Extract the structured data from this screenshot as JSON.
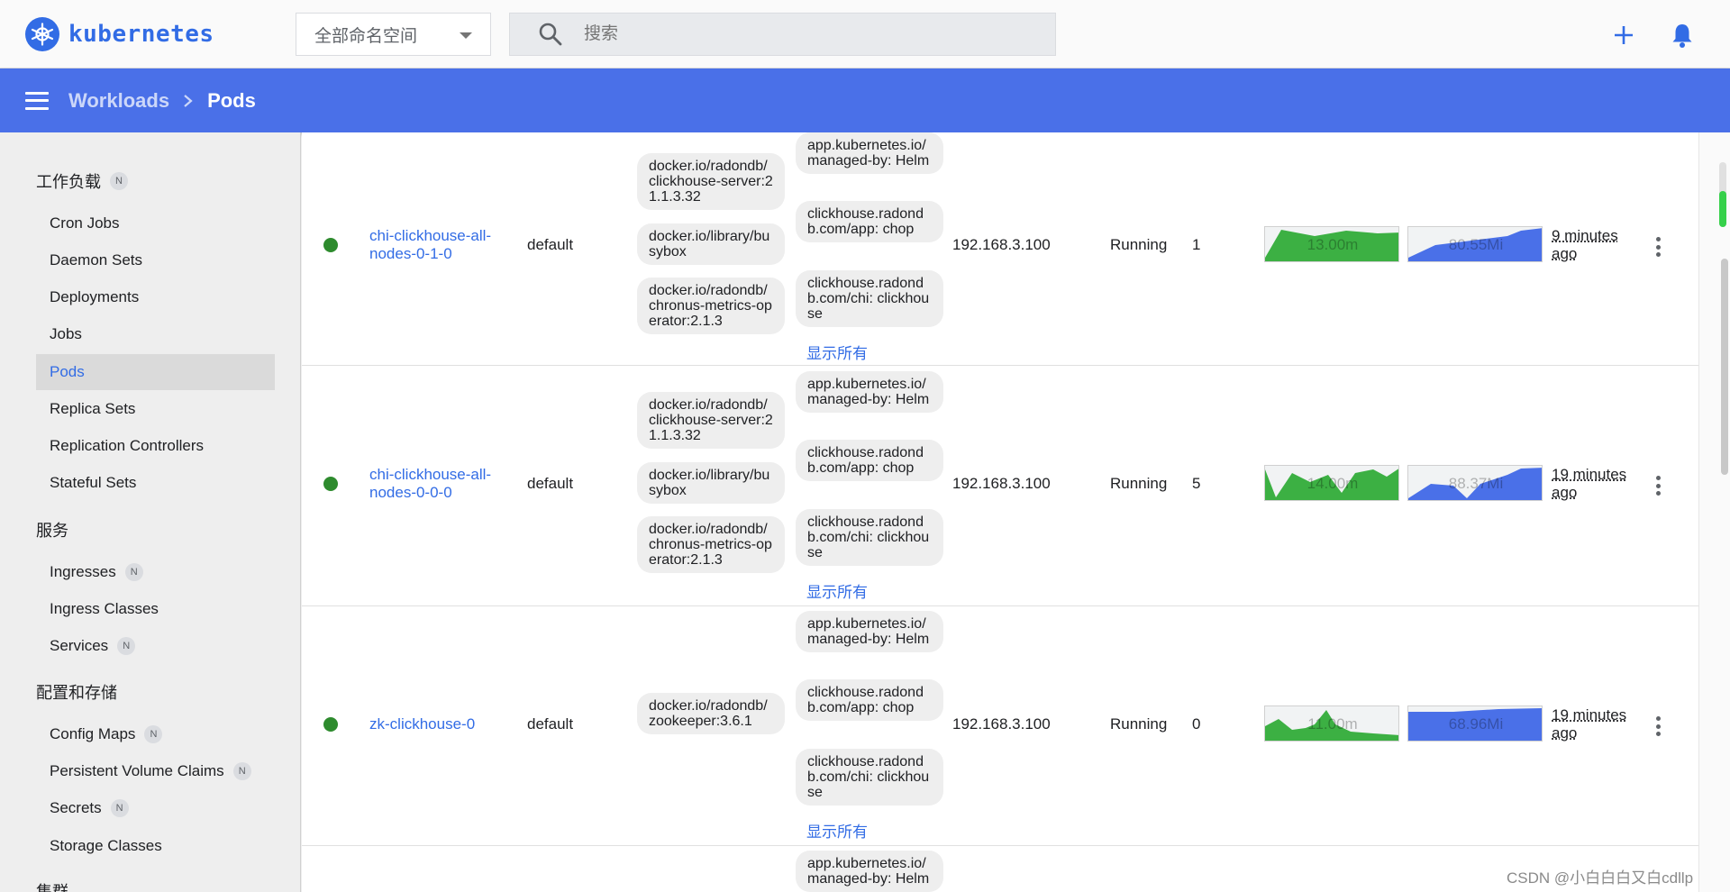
{
  "topbar": {
    "logo_text": "kubernetes",
    "namespace_select": "全部命名空间",
    "search_placeholder": "搜索"
  },
  "breadcrumb": {
    "parent": "Workloads",
    "current": "Pods"
  },
  "sidebar": {
    "sections": [
      {
        "label": "工作负载",
        "badge": "N"
      },
      {
        "label": "服务"
      },
      {
        "label": "配置和存储"
      },
      {
        "label": "集群"
      }
    ],
    "workloads": [
      "Cron Jobs",
      "Daemon Sets",
      "Deployments",
      "Jobs",
      "Pods",
      "Replica Sets",
      "Replication Controllers",
      "Stateful Sets"
    ],
    "services": [
      {
        "label": "Ingresses",
        "badge": "N"
      },
      {
        "label": "Ingress Classes"
      },
      {
        "label": "Services",
        "badge": "N"
      }
    ],
    "config": [
      {
        "label": "Config Maps",
        "badge": "N"
      },
      {
        "label": "Persistent Volume Claims",
        "badge": "N"
      },
      {
        "label": "Secrets",
        "badge": "N"
      },
      {
        "label": "Storage Classes"
      }
    ],
    "active": "Pods"
  },
  "pods": [
    {
      "name": "chi-clickhouse-all-nodes-0-1-0",
      "namespace": "default",
      "images": [
        "docker.io/radondb/clickhouse-server:21.1.3.32",
        "docker.io/library/busybox",
        "docker.io/radondb/chronus-metrics-operator:2.1.3"
      ],
      "labels": [
        "app.kubernetes.io/managed-by: Helm",
        "clickhouse.radondb.com/app: chop",
        "clickhouse.radondb.com/chi: clickhouse"
      ],
      "show_all": "显示所有",
      "node": "192.168.3.100",
      "status": "Running",
      "restarts": "1",
      "cpu": "13.00m",
      "memory": "80.55Mi",
      "age": "9 minutes ago"
    },
    {
      "name": "chi-clickhouse-all-nodes-0-0-0",
      "namespace": "default",
      "images": [
        "docker.io/radondb/clickhouse-server:21.1.3.32",
        "docker.io/library/busybox",
        "docker.io/radondb/chronus-metrics-operator:2.1.3"
      ],
      "labels": [
        "app.kubernetes.io/managed-by: Helm",
        "clickhouse.radondb.com/app: chop",
        "clickhouse.radondb.com/chi: clickhouse"
      ],
      "show_all": "显示所有",
      "node": "192.168.3.100",
      "status": "Running",
      "restarts": "5",
      "cpu": "14.00m",
      "memory": "88.37Mi",
      "age": "19 minutes ago"
    },
    {
      "name": "zk-clickhouse-0",
      "namespace": "default",
      "images": [
        "docker.io/radondb/zookeeper:3.6.1"
      ],
      "labels": [
        "app.kubernetes.io/managed-by: Helm",
        "clickhouse.radondb.com/app: chop",
        "clickhouse.radondb.com/chi: clickhouse"
      ],
      "show_all": "显示所有",
      "node": "192.168.3.100",
      "status": "Running",
      "restarts": "0",
      "cpu": "11.00m",
      "memory": "68.96Mi",
      "age": "19 minutes ago"
    },
    {
      "labels": [
        "app.kubernetes.io/managed-by: Helm"
      ]
    }
  ],
  "colors": {
    "brand": "#326ce5",
    "header": "#4a70e8",
    "running": "#2e8b2e",
    "cpu_spark": "#3cb043",
    "mem_spark": "#4a70e8"
  },
  "watermark": "CSDN @小白白白又白cdllp"
}
